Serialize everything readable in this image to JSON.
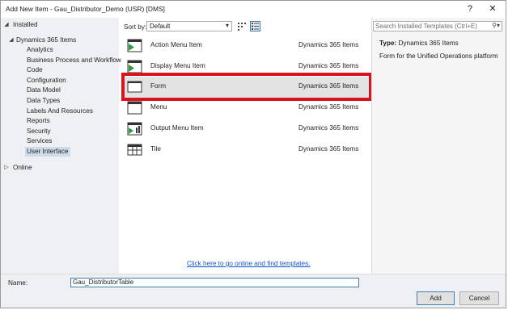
{
  "window": {
    "title": "Add New Item - Gau_Distributor_Demo (USR) [DMS]",
    "help_label": "?",
    "close_label": "✕"
  },
  "tree": {
    "installed_label": "Installed",
    "root_label": "Dynamics 365 Items",
    "children": [
      "Analytics",
      "Business Process and Workflow",
      "Code",
      "Configuration",
      "Data Model",
      "Data Types",
      "Labels And Resources",
      "Reports",
      "Security",
      "Services",
      "User Interface"
    ],
    "selected": "User Interface",
    "online_label": "Online"
  },
  "toolbar": {
    "sort_label": "Sort by:",
    "sort_value": "Default"
  },
  "templates": [
    {
      "name": "Action Menu Item",
      "category": "Dynamics 365 Items",
      "icon": "action-menu-item-icon"
    },
    {
      "name": "Display Menu Item",
      "category": "Dynamics 365 Items",
      "icon": "display-menu-item-icon"
    },
    {
      "name": "Form",
      "category": "Dynamics 365 Items",
      "icon": "form-icon"
    },
    {
      "name": "Menu",
      "category": "Dynamics 365 Items",
      "icon": "menu-icon"
    },
    {
      "name": "Output Menu Item",
      "category": "Dynamics 365 Items",
      "icon": "output-menu-item-icon"
    },
    {
      "name": "Tile",
      "category": "Dynamics 365 Items",
      "icon": "tile-icon"
    }
  ],
  "selected_template": "Form",
  "online_link": "Click here to go online and find templates.",
  "search": {
    "placeholder": "Search Installed Templates (Ctrl+E)"
  },
  "details": {
    "type_label": "Type:",
    "type_value": "Dynamics 365 Items",
    "description": "Form for the Unified Operations platform"
  },
  "footer": {
    "name_label": "Name:",
    "name_value": "Gau_DistributorTable",
    "add_label": "Add",
    "cancel_label": "Cancel"
  },
  "colors": {
    "highlight": "#d9141f",
    "link": "#1155cc",
    "accent_green": "#2e9c3c"
  }
}
